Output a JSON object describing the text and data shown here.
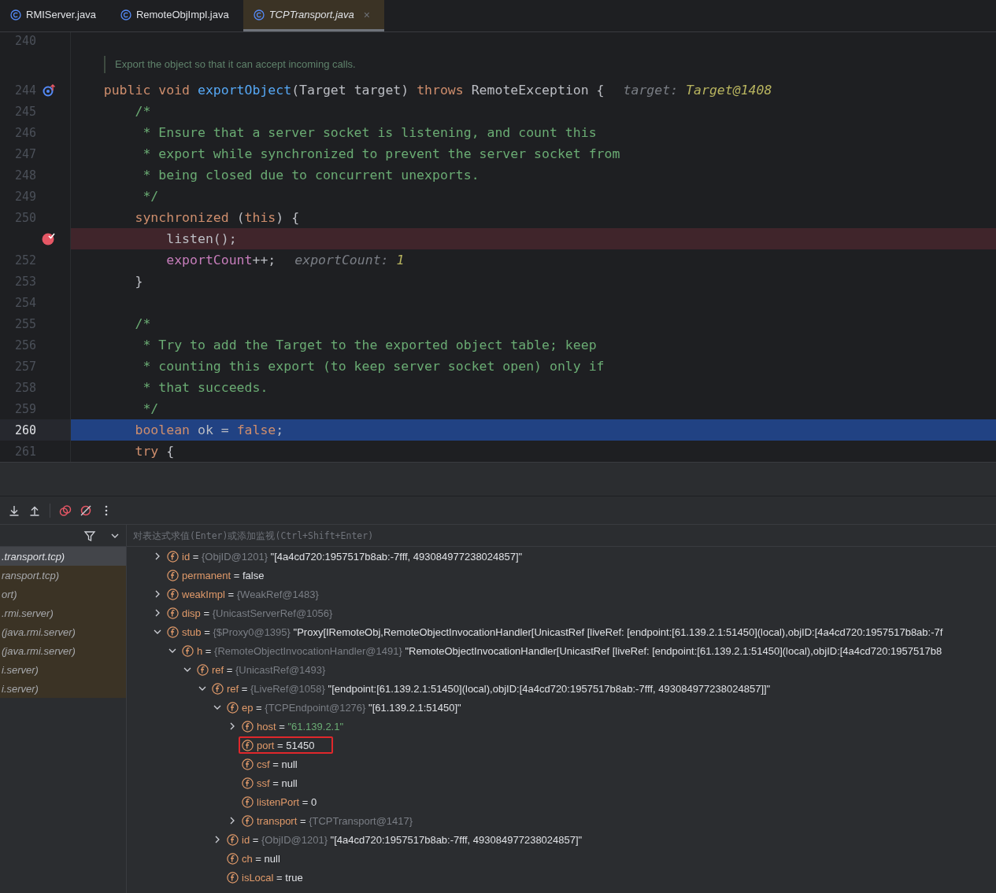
{
  "tabs": [
    {
      "label": "RMIServer.java",
      "selected": false,
      "preview": false
    },
    {
      "label": "RemoteObjImpl.java",
      "selected": false,
      "preview": false
    },
    {
      "label": "TCPTransport.java",
      "selected": true,
      "preview": true,
      "close": "×"
    }
  ],
  "editor": {
    "lines": [
      {
        "kind": "code",
        "number": "240"
      },
      {
        "kind": "doc",
        "text": "Export the object so that it can accept incoming calls."
      },
      {
        "kind": "code",
        "number": "244",
        "override_marker": true,
        "tokens": [
          {
            "kind": "kw",
            "text": "    public void "
          },
          {
            "kind": "fn",
            "text": "exportObject"
          },
          {
            "kind": "plain",
            "text": "(Target target) "
          },
          {
            "kind": "kw",
            "text": "throws "
          },
          {
            "kind": "plain",
            "text": "RemoteException {"
          }
        ],
        "hint": {
          "label": "target:",
          "value": "Target@1408"
        }
      },
      {
        "kind": "code",
        "number": "245",
        "tokens": [
          {
            "kind": "comment",
            "text": "        /*"
          }
        ]
      },
      {
        "kind": "code",
        "number": "246",
        "tokens": [
          {
            "kind": "comment",
            "text": "         * Ensure that a server socket is listening, and count this"
          }
        ]
      },
      {
        "kind": "code",
        "number": "247",
        "tokens": [
          {
            "kind": "comment",
            "text": "         * export while synchronized to prevent the server socket from"
          }
        ]
      },
      {
        "kind": "code",
        "number": "248",
        "tokens": [
          {
            "kind": "comment",
            "text": "         * being closed due to concurrent unexports."
          }
        ]
      },
      {
        "kind": "code",
        "number": "249",
        "tokens": [
          {
            "kind": "comment",
            "text": "         */"
          }
        ]
      },
      {
        "kind": "code",
        "number": "250",
        "tokens": [
          {
            "kind": "kw",
            "text": "        synchronized "
          },
          {
            "kind": "plain",
            "text": "("
          },
          {
            "kind": "kw",
            "text": "this"
          },
          {
            "kind": "plain",
            "text": ") {"
          }
        ]
      },
      {
        "kind": "code",
        "breakpoint": true,
        "tokens": [
          {
            "kind": "plain",
            "text": "            listen();"
          }
        ]
      },
      {
        "kind": "code",
        "number": "252",
        "tokens": [
          {
            "kind": "field",
            "text": "            exportCount"
          },
          {
            "kind": "plain",
            "text": "++;"
          }
        ],
        "hint": {
          "label": "exportCount:",
          "value": "1"
        }
      },
      {
        "kind": "code",
        "number": "253",
        "tokens": [
          {
            "kind": "plain",
            "text": "        }"
          }
        ]
      },
      {
        "kind": "code",
        "number": "254"
      },
      {
        "kind": "code",
        "number": "255",
        "tokens": [
          {
            "kind": "comment",
            "text": "        /*"
          }
        ]
      },
      {
        "kind": "code",
        "number": "256",
        "tokens": [
          {
            "kind": "comment",
            "text": "         * Try to add the Target to the exported object table; keep"
          }
        ]
      },
      {
        "kind": "code",
        "number": "257",
        "tokens": [
          {
            "kind": "comment",
            "text": "         * counting this export (to keep server socket open) only if"
          }
        ]
      },
      {
        "kind": "code",
        "number": "258",
        "tokens": [
          {
            "kind": "comment",
            "text": "         * that succeeds."
          }
        ]
      },
      {
        "kind": "code",
        "number": "259",
        "tokens": [
          {
            "kind": "comment",
            "text": "         */"
          }
        ]
      },
      {
        "kind": "code",
        "number": "260",
        "current": true,
        "tokens": [
          {
            "kind": "kw",
            "text": "        boolean "
          },
          {
            "kind": "plain",
            "text": "ok = "
          },
          {
            "kind": "kw",
            "text": "false"
          },
          {
            "kind": "plain",
            "text": ";"
          }
        ]
      },
      {
        "kind": "code",
        "number": "261",
        "tokens": [
          {
            "kind": "kw",
            "text": "        try "
          },
          {
            "kind": "plain",
            "text": "{"
          }
        ]
      }
    ]
  },
  "debugger": {
    "evaluate": {
      "placeholder": "对表达式求值(Enter)或添加监视(Ctrl+Shift+Enter)"
    },
    "frames": [
      {
        "text": ".transport.tcp)",
        "selected": true
      },
      {
        "text": "ransport.tcp)",
        "selected": false
      },
      {
        "text": "ort)",
        "selected": false
      },
      {
        "text": ".rmi.server)",
        "selected": false
      },
      {
        "text": "(java.rmi.server)",
        "selected": false
      },
      {
        "text": "(java.rmi.server)",
        "selected": false
      },
      {
        "text": "i.server)",
        "selected": false
      },
      {
        "text": "i.server)",
        "selected": false
      }
    ],
    "variables": [
      {
        "name": "id",
        "op": "=",
        "type": "{ObjID@1201}",
        "value": "\"[4a4cd720:1957517b8ab:-7fff, 493084977238024857]\"",
        "expanded": false
      },
      {
        "name": "permanent",
        "op": "=",
        "value": "false"
      },
      {
        "name": "weakImpl",
        "op": "=",
        "type": "{WeakRef@1483}",
        "expanded": false
      },
      {
        "name": "disp",
        "op": "=",
        "type": "{UnicastServerRef@1056}",
        "expanded": false
      },
      {
        "name": "stub",
        "op": "=",
        "type": "{$Proxy0@1395}",
        "value": "\"Proxy[IRemoteObj,RemoteObjectInvocationHandler[UnicastRef [liveRef: [endpoint:[61.139.2.1:51450](local),objID:[4a4cd720:1957517b8ab:-7f",
        "expanded": true,
        "children": [
          {
            "name": "h",
            "op": "=",
            "type": "{RemoteObjectInvocationHandler@1491}",
            "value": "\"RemoteObjectInvocationHandler[UnicastRef [liveRef: [endpoint:[61.139.2.1:51450](local),objID:[4a4cd720:1957517b8",
            "expanded": true,
            "children": [
              {
                "name": "ref",
                "op": "=",
                "type": "{UnicastRef@1493}",
                "expanded": true,
                "children": [
                  {
                    "name": "ref",
                    "op": "=",
                    "type": "{LiveRef@1058}",
                    "value": "\"[endpoint:[61.139.2.1:51450](local),objID:[4a4cd720:1957517b8ab:-7fff, 493084977238024857]]\"",
                    "expanded": true,
                    "children": [
                      {
                        "name": "ep",
                        "op": "=",
                        "type": "{TCPEndpoint@1276}",
                        "value": "\"[61.139.2.1:51450]\"",
                        "expanded": true,
                        "children": [
                          {
                            "name": "host",
                            "op": "=",
                            "value": "\"61.139.2.1\"",
                            "string_value": true,
                            "expanded": false
                          },
                          {
                            "name": "port",
                            "op": "=",
                            "value": "51450",
                            "boxed": true
                          },
                          {
                            "name": "csf",
                            "op": "=",
                            "value": "null"
                          },
                          {
                            "name": "ssf",
                            "op": "=",
                            "value": "null"
                          },
                          {
                            "name": "listenPort",
                            "op": "=",
                            "value": "0"
                          },
                          {
                            "name": "transport",
                            "op": "=",
                            "type": "{TCPTransport@1417}",
                            "expanded": false
                          }
                        ]
                      },
                      {
                        "name": "id",
                        "op": "=",
                        "type": "{ObjID@1201}",
                        "value": "\"[4a4cd720:1957517b8ab:-7fff, 493084977238024857]\"",
                        "expanded": false
                      },
                      {
                        "name": "ch",
                        "op": "=",
                        "value": "null"
                      },
                      {
                        "name": "isLocal",
                        "op": "=",
                        "value": "true"
                      }
                    ]
                  }
                ]
              }
            ]
          }
        ]
      }
    ]
  }
}
